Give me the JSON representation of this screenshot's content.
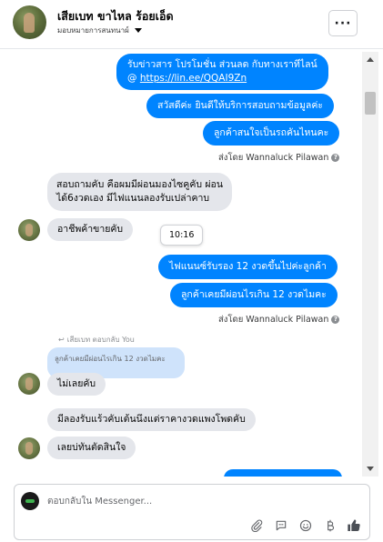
{
  "header": {
    "name": "เสียเบท ขาไหล ร้อยเอ็ด",
    "subtitle": "มอบหมายการสนทนาผ์",
    "more_label": "···"
  },
  "thread": {
    "messages_top": [
      {
        "text_line1": "รับข่าวสาร  โปรโมชั่น ส่วนลด กับทางเราทีไลน์",
        "text_line2_prefix": "@ ",
        "link": "https://lin.ee/QQAI9Zn"
      },
      {
        "text": "สวัสดีค่ะ  ยินดีให้บริการสอบถามข้อมูลค่ะ"
      },
      {
        "text": "ลูกค้าสนใจเป็นรถคันไหนคะ"
      }
    ],
    "sent_by_1": "ส่งโดย Wannaluck Pilawan",
    "incoming_1": {
      "line1": "สอบถามคับ  คือผมมีผ่อนมองไซคูคับ ผ่อน",
      "line2": "ได้6งวดเอง มีไฟแนนลองรับเปล่าคาบ"
    },
    "incoming_2": "อาชีพค้าขายคับ",
    "timestamp": "10:16",
    "messages_mid": [
      {
        "text": "ไฟแนนซ์รับรอง 12 งวดขึ้นไปค่ะลูกค้า"
      },
      {
        "text": "ลูกค้าเคยมีผ่อนไรเกิน 12 งวดไมคะ"
      }
    ],
    "sent_by_2": "ส่งโดย Wannaluck Pilawan",
    "reply_meta": "เสียเบท ตอบกลับ You",
    "quoted": "ลูกค้าเคยมีผ่อนไรเกิน 12 งวดไมคะ",
    "incoming_3": "ไม่เลยคับ",
    "incoming_4": "มีลองรับแร้วคับเต้นนึงแต่ราคางวดแพงโพดคับ",
    "incoming_5": "เลยบ่ทันตัดสินใจ"
  },
  "composer": {
    "placeholder": "ตอบกลับใน Messenger..."
  },
  "colors": {
    "outgoing_bubble": "#0084ff",
    "incoming_bubble": "#e4e6eb",
    "quoted_bubble": "#cfe3fb"
  },
  "icons": [
    "chevron-down-icon",
    "more-icon",
    "question-icon",
    "reply-icon",
    "attachment-icon",
    "chat-icon",
    "emoji-icon",
    "baht-icon",
    "thumbs-up-icon"
  ]
}
